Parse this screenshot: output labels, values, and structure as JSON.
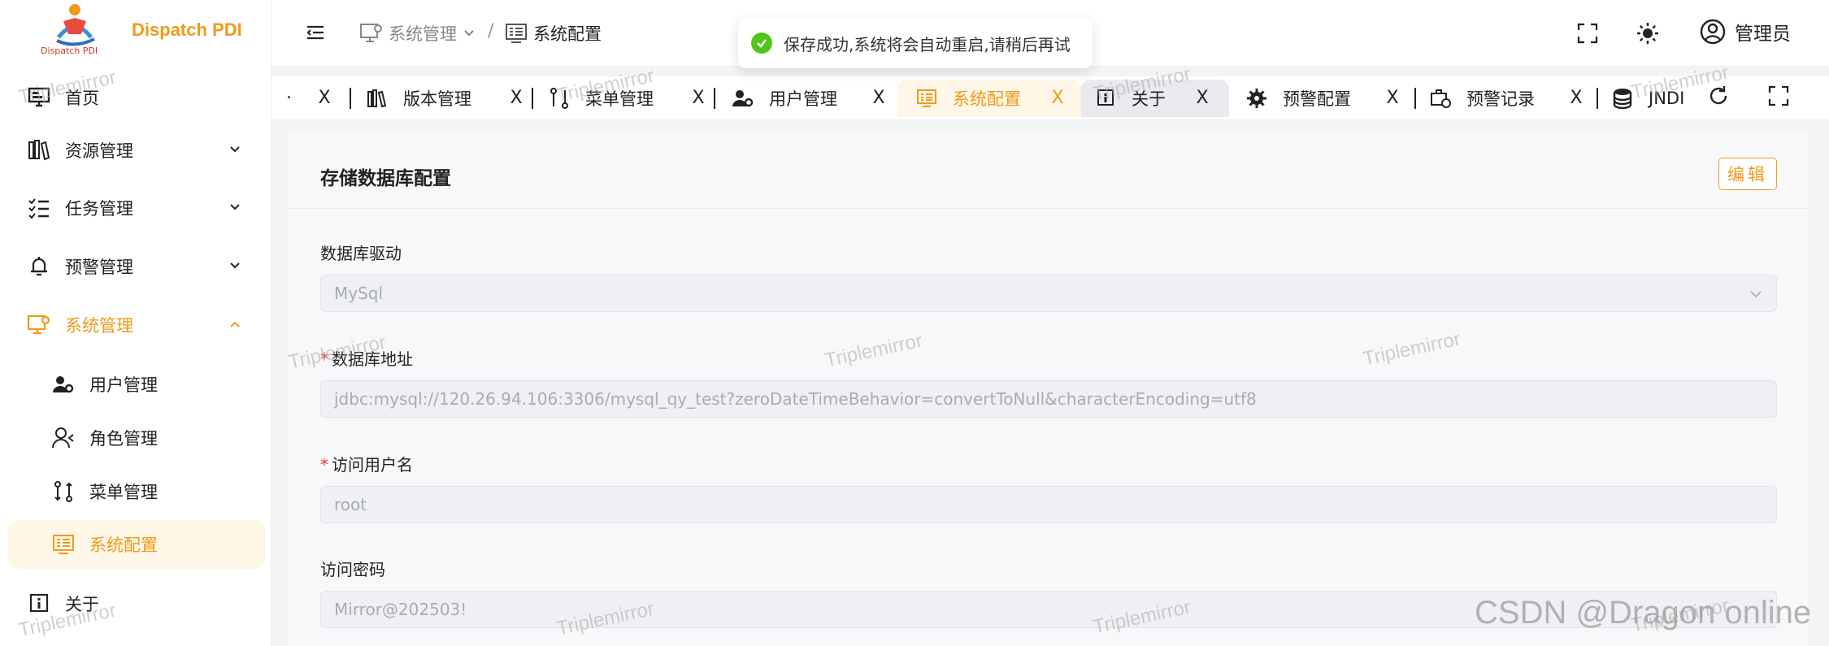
{
  "brand": {
    "name": "Dispatch PDI",
    "sub": "Dispatch PDI"
  },
  "sidebar": {
    "items": [
      {
        "label": "首页"
      },
      {
        "label": "资源管理"
      },
      {
        "label": "任务管理"
      },
      {
        "label": "预警管理"
      },
      {
        "label": "系统管理"
      },
      {
        "label": "用户管理"
      },
      {
        "label": "角色管理"
      },
      {
        "label": "菜单管理"
      },
      {
        "label": "系统配置"
      },
      {
        "label": "关于"
      }
    ]
  },
  "header": {
    "breadcrumb": [
      "系统管理",
      "系统配置"
    ],
    "separator": "/",
    "user": "管理员"
  },
  "toast": {
    "message": "保存成功,系统将会自动重启,请稍后再试"
  },
  "tabs": [
    {
      "label": "版本管理"
    },
    {
      "label": "菜单管理"
    },
    {
      "label": "用户管理"
    },
    {
      "label": "系统配置"
    },
    {
      "label": "关于"
    },
    {
      "label": "预警配置"
    },
    {
      "label": "预警记录"
    },
    {
      "label": "JNDI"
    }
  ],
  "tab_close": "X",
  "tab_cut": ".",
  "form": {
    "title": "存储数据库配置",
    "edit_label": "编辑",
    "driver": {
      "label": "数据库驱动",
      "value": "MySql"
    },
    "url": {
      "label": "数据库地址",
      "value": "jdbc:mysql://120.26.94.106:3306/mysql_qy_test?zeroDateTimeBehavior=convertToNull&characterEncoding=utf8"
    },
    "username": {
      "label": "访问用户名",
      "value": "root"
    },
    "password": {
      "label": "访问密码",
      "value": "Mirror@202503!"
    },
    "required_mark": "*"
  },
  "watermark": "Triplemirror",
  "csdn_mark": "CSDN @Dragon online",
  "colors": {
    "accent": "#f09a1a",
    "success": "#52c41a",
    "required": "#e53935"
  }
}
